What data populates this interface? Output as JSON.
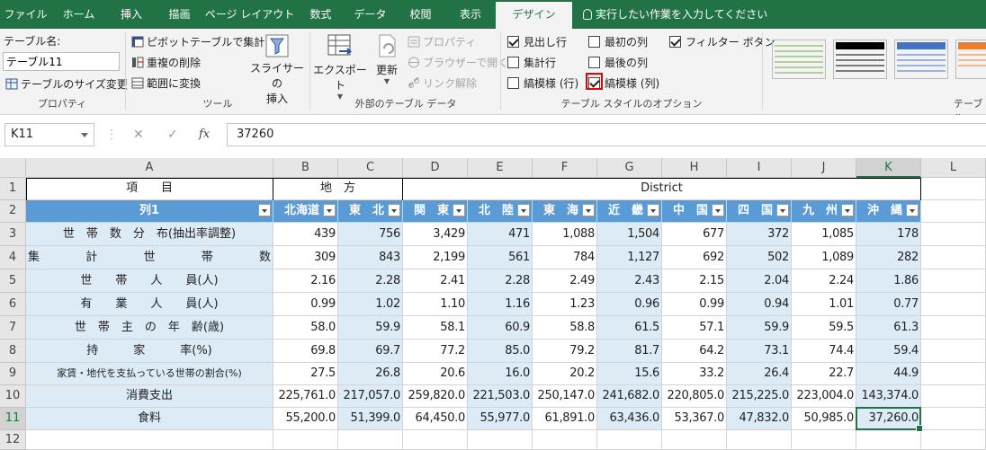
{
  "tabs": [
    "ファイル",
    "ホーム",
    "挿入",
    "描画",
    "ページ レイアウト",
    "数式",
    "データ",
    "校閲",
    "表示",
    "デザイン"
  ],
  "active_tab": "デザイン",
  "tell_me": "実行したい作業を入力してください",
  "ribbon": {
    "props": {
      "name_label": "テーブル名:",
      "name_value": "テーブル11",
      "resize": "テーブルのサイズ変更",
      "group": "プロパティ"
    },
    "tools": {
      "pivot": "ピボットテーブルで集計",
      "dedupe": "重複の削除",
      "convert": "範囲に変換",
      "slicer": "スライサーの\n挿入",
      "group": "ツール"
    },
    "external": {
      "export": "エクスポート",
      "refresh": "更新",
      "properties": "プロパティ",
      "browser": "ブラウザーで開く",
      "unlink": "リンク解除",
      "group": "外部のテーブル データ"
    },
    "options": {
      "header_row": "見出し行",
      "total_row": "集計行",
      "banded_rows": "縞模様 (行)",
      "first_col": "最初の列",
      "last_col": "最後の列",
      "banded_cols": "縞模様 (列)",
      "filter_btn": "フィルター ボタン",
      "group": "テーブル スタイルのオプション",
      "checked": {
        "header_row": true,
        "total_row": false,
        "banded_rows": false,
        "first_col": false,
        "last_col": false,
        "banded_cols": true,
        "filter_btn": true
      }
    },
    "styles_group": "テーブル"
  },
  "formula_bar": {
    "name_box": "K11",
    "formula": "37260"
  },
  "columns": [
    "A",
    "B",
    "C",
    "D",
    "E",
    "F",
    "G",
    "H",
    "I",
    "J",
    "K",
    "L"
  ],
  "rows": [
    "1",
    "2",
    "3",
    "4",
    "5",
    "6",
    "7",
    "8",
    "9",
    "10",
    "11",
    "12"
  ],
  "sheet": {
    "a1": "項　　目",
    "chiho": "地　方",
    "district": "District",
    "col1": "列1",
    "regions": [
      "北海道",
      "東　北",
      "関　東",
      "北　陸",
      "東　海",
      "近　畿",
      "中　国",
      "四　国",
      "九　州",
      "沖　縄"
    ],
    "data_rows": [
      {
        "label": "世　帯　数　分　布(抽出率調整)",
        "values": [
          "439",
          "756",
          "3,429",
          "471",
          "1,088",
          "1,504",
          "677",
          "372",
          "1,085",
          "178"
        ]
      },
      {
        "label": "集　　計　　世　　帯　　数",
        "values": [
          "309",
          "843",
          "2,199",
          "561",
          "784",
          "1,127",
          "692",
          "502",
          "1,089",
          "282"
        ]
      },
      {
        "label": "世　　帯　　人　　員(人)",
        "values": [
          "2.16",
          "2.28",
          "2.41",
          "2.28",
          "2.49",
          "2.43",
          "2.15",
          "2.04",
          "2.24",
          "1.86"
        ]
      },
      {
        "label": "有　　業　　人　　員(人)",
        "values": [
          "0.99",
          "1.02",
          "1.10",
          "1.16",
          "1.23",
          "0.96",
          "0.99",
          "0.94",
          "1.01",
          "0.77"
        ]
      },
      {
        "label": "世　帯　主　の　年　齢(歳)",
        "values": [
          "58.0",
          "59.9",
          "58.1",
          "60.9",
          "58.8",
          "61.5",
          "57.1",
          "59.9",
          "59.5",
          "61.3"
        ]
      },
      {
        "label": "持　　　家　　　率(%)",
        "values": [
          "69.8",
          "69.7",
          "77.2",
          "85.0",
          "79.2",
          "81.7",
          "64.2",
          "73.1",
          "74.4",
          "59.4"
        ]
      },
      {
        "label": "家賃・地代を支払っている世帯の割合(%)",
        "values": [
          "27.5",
          "26.8",
          "20.6",
          "16.0",
          "20.2",
          "15.6",
          "33.2",
          "26.4",
          "22.7",
          "44.9"
        ]
      },
      {
        "label": "消費支出",
        "values": [
          "225,761.0",
          "217,057.0",
          "259,820.0",
          "221,503.0",
          "250,147.0",
          "241,682.0",
          "220,805.0",
          "215,225.0",
          "223,004.0",
          "143,374.0"
        ]
      },
      {
        "label": "食料",
        "values": [
          "55,200.0",
          "51,399.0",
          "64,450.0",
          "55,977.0",
          "61,891.0",
          "63,436.0",
          "53,367.0",
          "47,832.0",
          "50,985.0",
          "37,260.0"
        ]
      }
    ]
  },
  "colors": {
    "accent": "#217346",
    "header_fill": "#5b9bd5",
    "band_fill": "#ddebf7"
  }
}
